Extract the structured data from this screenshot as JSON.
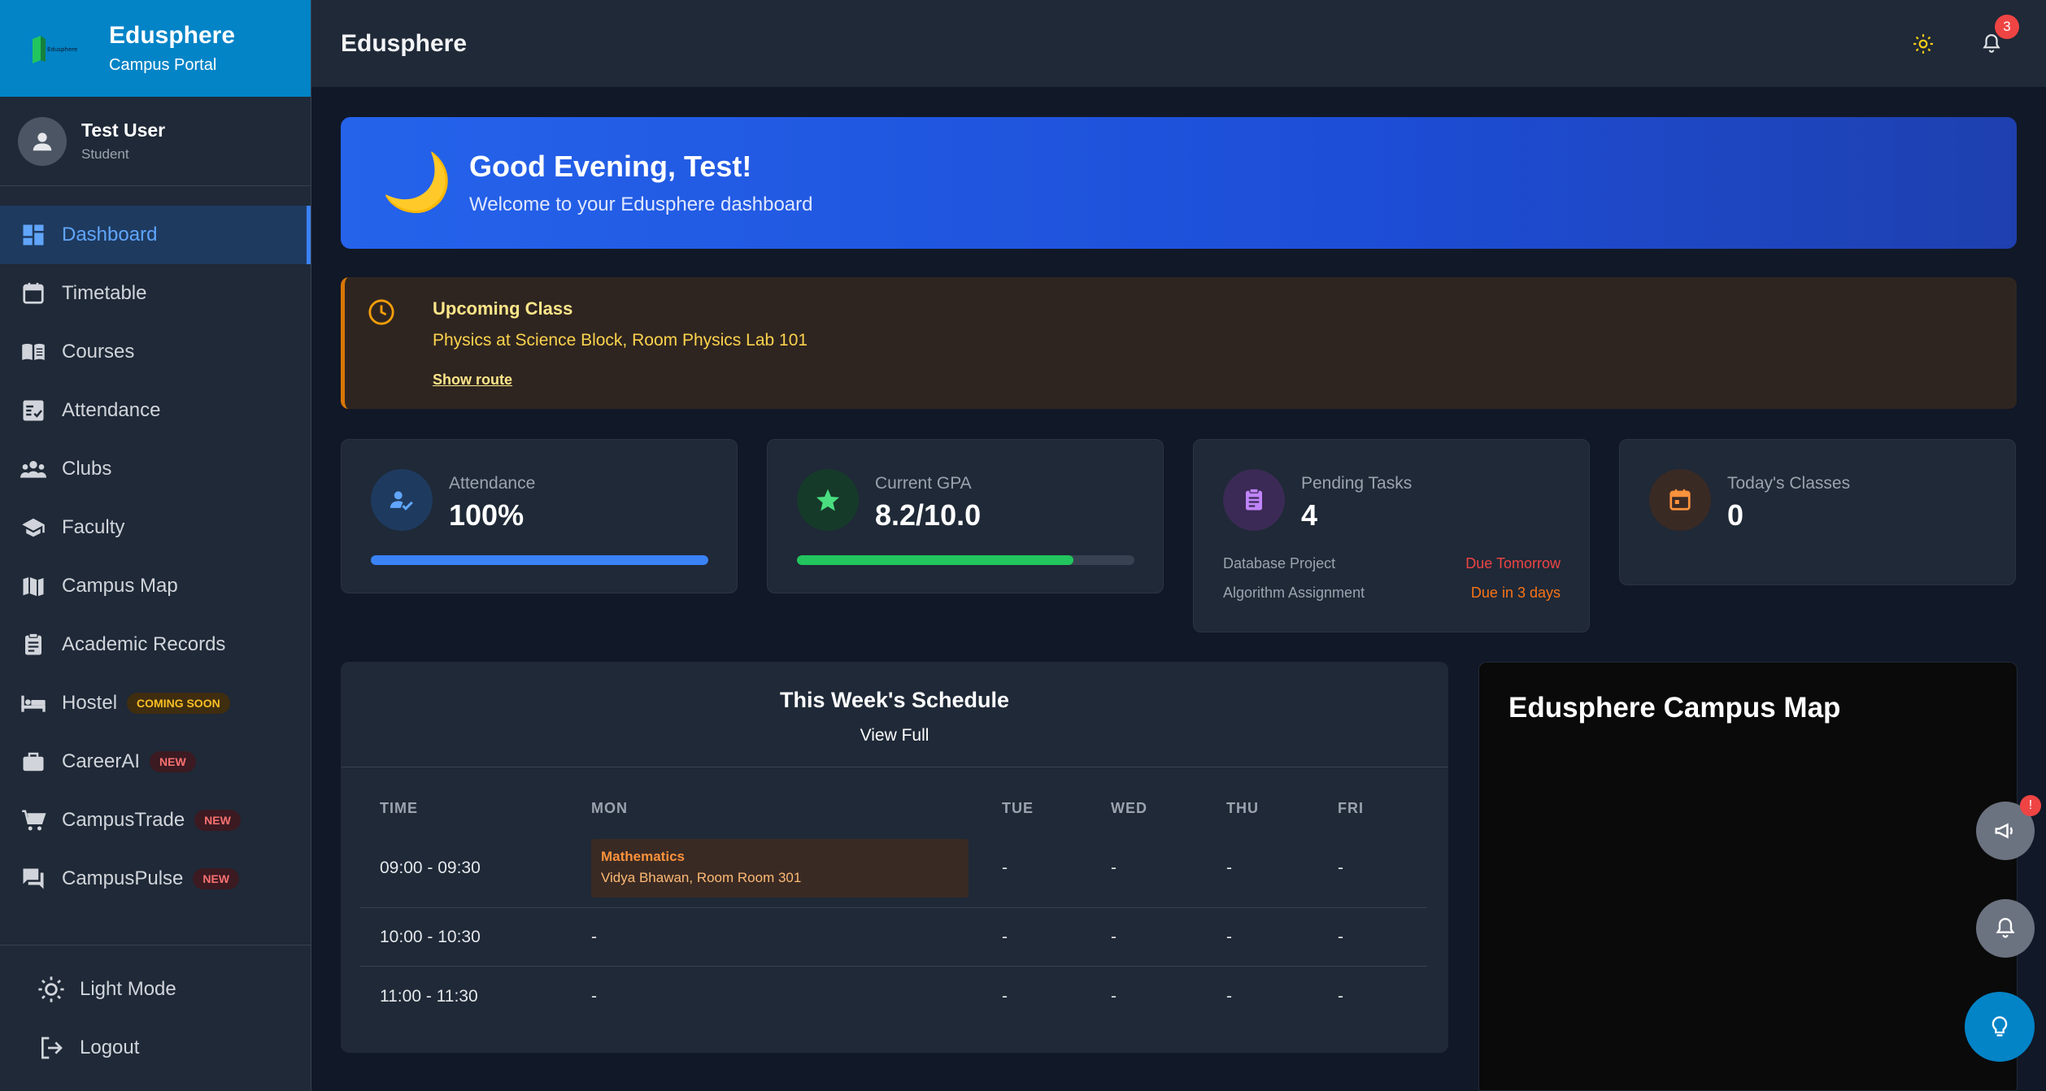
{
  "brand": {
    "title": "Edusphere",
    "subtitle": "Campus Portal",
    "logo_text": "Edusphere"
  },
  "user": {
    "name": "Test User",
    "role": "Student"
  },
  "sidebar": {
    "items": [
      {
        "label": "Dashboard",
        "icon": "dashboard-icon",
        "active": true
      },
      {
        "label": "Timetable",
        "icon": "calendar-icon"
      },
      {
        "label": "Courses",
        "icon": "book-icon"
      },
      {
        "label": "Attendance",
        "icon": "checklist-icon"
      },
      {
        "label": "Clubs",
        "icon": "group-icon"
      },
      {
        "label": "Faculty",
        "icon": "graduation-cap-icon"
      },
      {
        "label": "Campus Map",
        "icon": "map-icon"
      },
      {
        "label": "Academic Records",
        "icon": "clipboard-icon"
      },
      {
        "label": "Hostel",
        "icon": "bed-icon",
        "badge": "COMING SOON"
      },
      {
        "label": "CareerAI",
        "icon": "briefcase-icon",
        "badge": "NEW"
      },
      {
        "label": "CampusTrade",
        "icon": "cart-icon",
        "badge": "NEW"
      },
      {
        "label": "CampusPulse",
        "icon": "chat-icon",
        "badge": "NEW"
      }
    ],
    "bottom": {
      "light_mode": "Light Mode",
      "logout": "Logout"
    }
  },
  "header": {
    "title": "Edusphere",
    "notification_count": "3"
  },
  "welcome": {
    "title": "Good Evening, Test!",
    "subtitle": "Welcome to your Edusphere dashboard",
    "emoji": "🌙"
  },
  "upcoming": {
    "title": "Upcoming Class",
    "description": "Physics at Science Block, Room Physics Lab 101",
    "link": "Show route"
  },
  "stats": {
    "attendance": {
      "label": "Attendance",
      "value": "100%",
      "progress": 1.0,
      "color": "#3b82f6"
    },
    "gpa": {
      "label": "Current GPA",
      "value": "8.2/10.0",
      "progress": 0.82,
      "color": "#22c55e"
    },
    "tasks": {
      "label": "Pending Tasks",
      "value": "4",
      "items": [
        {
          "name": "Database Project",
          "due": "Due Tomorrow",
          "color": "#ef4444"
        },
        {
          "name": "Algorithm Assignment",
          "due": "Due in 3 days",
          "color": "#f97316"
        }
      ]
    },
    "classes": {
      "label": "Today's Classes",
      "value": "0"
    }
  },
  "schedule": {
    "title": "This Week's Schedule",
    "view_full": "View Full",
    "columns": [
      "TIME",
      "MON",
      "TUE",
      "WED",
      "THU",
      "FRI"
    ],
    "rows": [
      {
        "time": "09:00 - 09:30",
        "mon": {
          "name": "Mathematics",
          "room": "Vidya Bhawan, Room Room 301"
        },
        "tue": "-",
        "wed": "-",
        "thu": "-",
        "fri": "-"
      },
      {
        "time": "10:00 - 10:30",
        "mon": "-",
        "tue": "-",
        "wed": "-",
        "thu": "-",
        "fri": "-"
      },
      {
        "time": "11:00 - 11:30",
        "mon": "-",
        "tue": "-",
        "wed": "-",
        "thu": "-",
        "fri": "-"
      }
    ]
  },
  "map": {
    "title": "Edusphere Campus Map"
  },
  "fabs": {
    "announce_badge": "!"
  },
  "colors": {
    "brand": "#0284c7",
    "accent": "#3b82f6",
    "background": "#111827",
    "panel": "#1f2937"
  }
}
